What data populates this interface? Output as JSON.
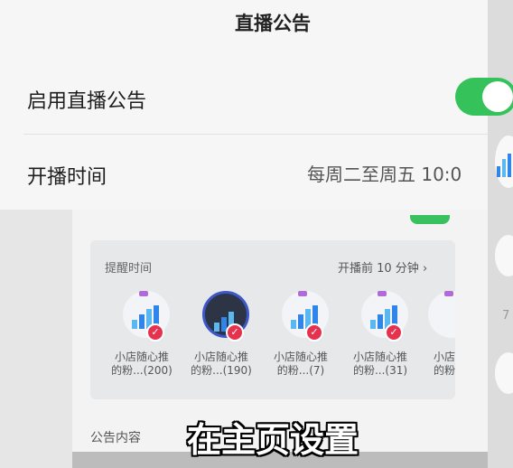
{
  "header": {
    "title": "直播公告"
  },
  "settings": {
    "enable": {
      "label": "启用直播公告",
      "on": true
    },
    "start_time": {
      "label": "开播时间",
      "value": "每周二至周五 10:0"
    }
  },
  "reminder": {
    "label": "提醒时间",
    "value": "开播前 10 分钟",
    "chevron": "chevron-right-icon",
    "fans": [
      {
        "name": "小店随心推",
        "detail": "的粉...(200)",
        "avatar": "bar-chart-avatar"
      },
      {
        "name": "小店随心推",
        "detail": "的粉...(190)",
        "avatar": "profile-avatar"
      },
      {
        "name": "小店随心推",
        "detail": "的粉...(7)",
        "avatar": "bar-chart-avatar"
      },
      {
        "name": "小店随心推",
        "detail": "的粉...(31)",
        "avatar": "bar-chart-avatar"
      },
      {
        "name": "小店",
        "detail": "的粉",
        "avatar": "bar-chart-avatar"
      }
    ]
  },
  "content": {
    "label": "公告内容"
  },
  "side": {
    "char": "7"
  },
  "subtitles": {
    "main": "在主页设置",
    "second": "…………"
  },
  "colors": {
    "toggle_on": "#35c25a",
    "check_badge": "#e5324e",
    "accent_blue": "#2f86e8"
  }
}
